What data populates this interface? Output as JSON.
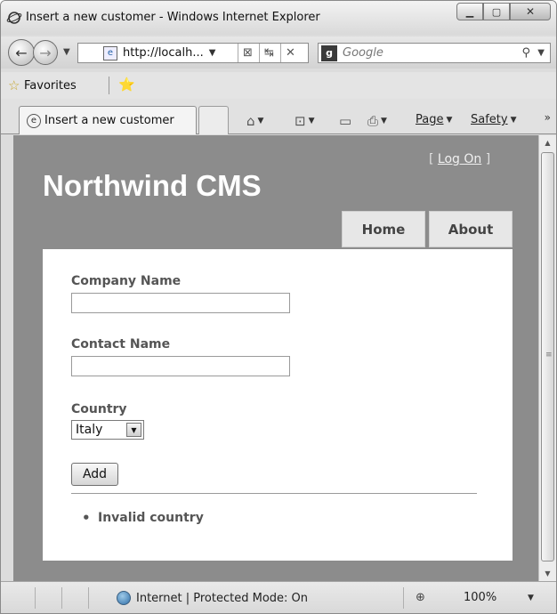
{
  "window": {
    "title": "Insert a new customer - Windows Internet Explorer"
  },
  "toolbar": {
    "address": "http://localh...",
    "search_placeholder": "Google"
  },
  "favorites": {
    "label": "Favorites"
  },
  "tab": {
    "label": "Insert a new customer"
  },
  "commands": {
    "page": "Page",
    "safety": "Safety"
  },
  "site": {
    "logon_open": "[ ",
    "logon_link": "Log On",
    "logon_close": " ]",
    "title": "Northwind CMS",
    "menu": {
      "home": "Home",
      "about": "About"
    }
  },
  "form": {
    "company_label": "Company Name",
    "company_value": "",
    "contact_label": "Contact Name",
    "contact_value": "",
    "country_label": "Country",
    "country_selected": "Italy",
    "add_label": "Add"
  },
  "errors": [
    "Invalid country"
  ],
  "status": {
    "zone": "Internet | Protected Mode: On",
    "zoom": "100%"
  },
  "icons": {
    "app": "ie-logo-icon",
    "back": "back-arrow-icon",
    "forward": "forward-arrow-icon",
    "search": "search-icon",
    "favorites": "favorites-star-icon",
    "home": "home-icon",
    "feeds": "feeds-icon",
    "mail": "mail-icon",
    "print": "print-icon",
    "globe": "globe-icon",
    "zoom": "zoom-icon"
  }
}
